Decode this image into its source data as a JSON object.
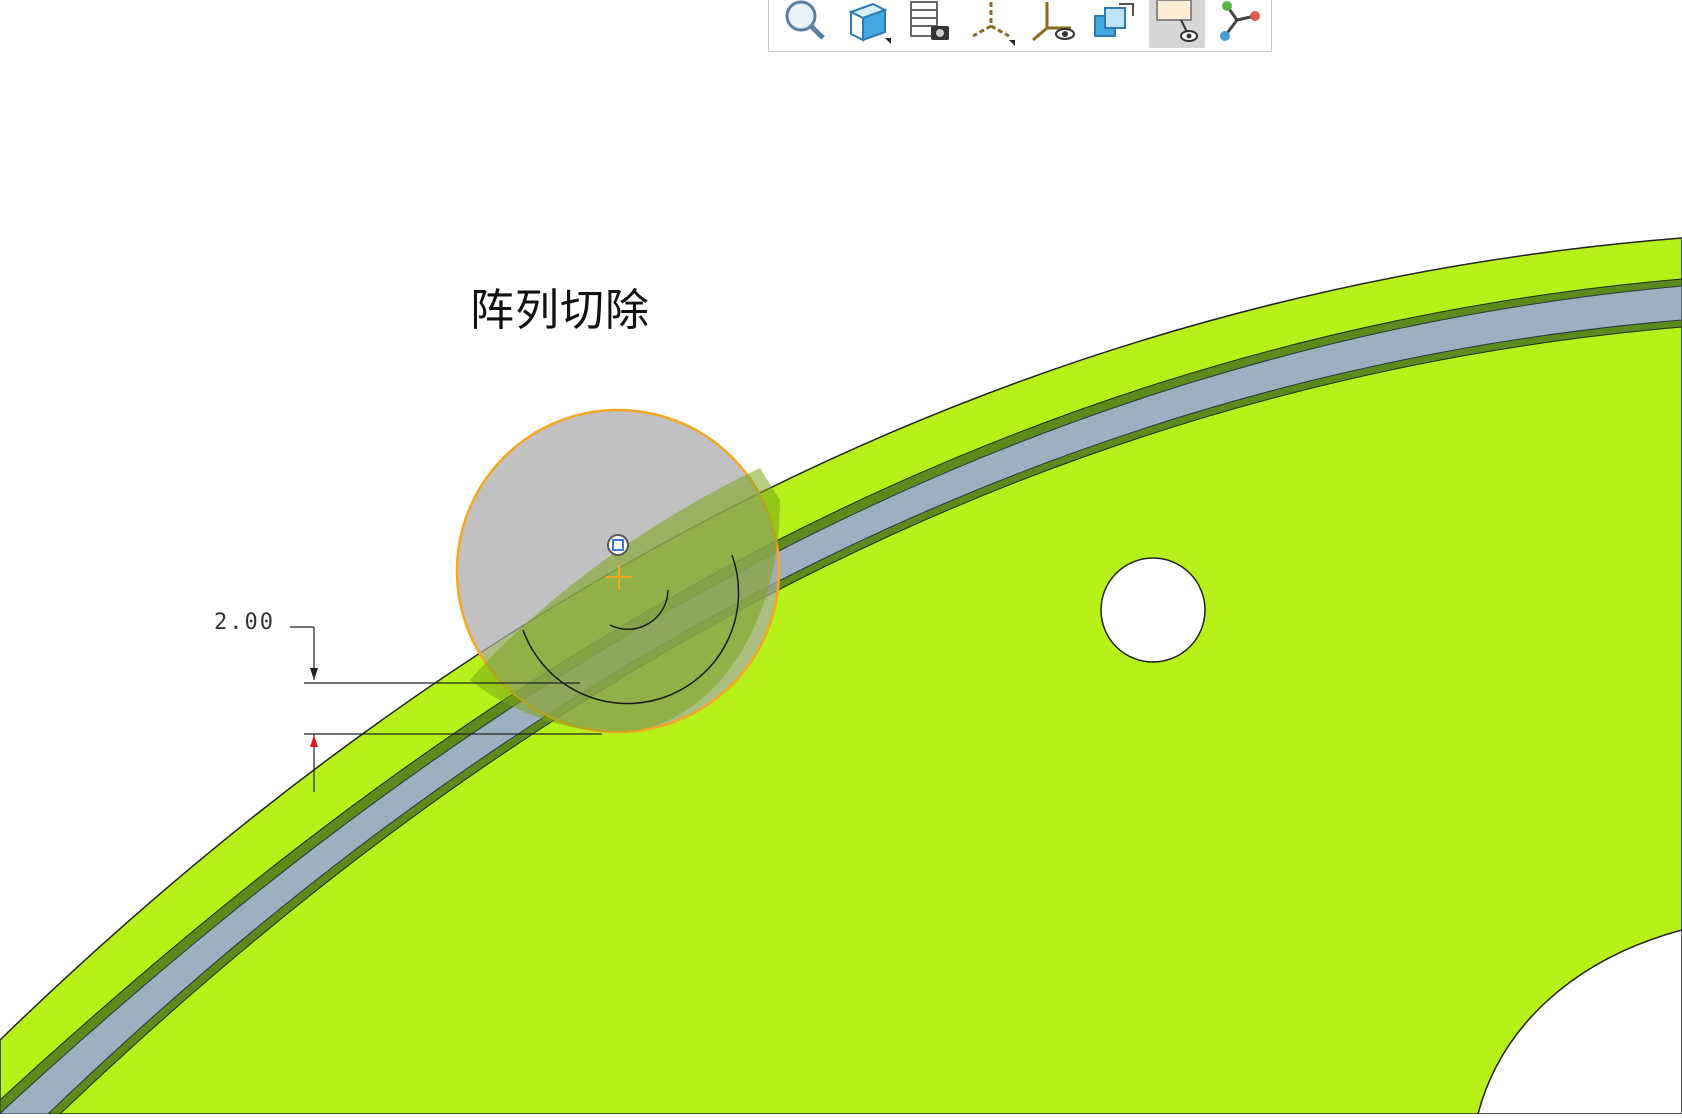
{
  "toolbar": {
    "buttons": [
      {
        "icon": "zoom-icon",
        "active": false
      },
      {
        "icon": "view-cube-icon",
        "active": false
      },
      {
        "icon": "saved-views-icon",
        "active": false
      },
      {
        "icon": "datum-axis-display-icon",
        "active": false
      },
      {
        "icon": "coordinate-system-display-icon",
        "active": false
      },
      {
        "icon": "spin-center-icon",
        "active": false
      },
      {
        "icon": "annotation-display-icon",
        "active": true
      },
      {
        "icon": "model-tree-icon",
        "active": false
      }
    ]
  },
  "model": {
    "feature_label": "阵列切除",
    "dimension_value": "2.00",
    "colors": {
      "part": "#b6f21a",
      "groove": "#9eafbf",
      "groove_edge": "#5d8a1b",
      "highlight": "#f5a623",
      "preview_sphere": "#a9a9a9"
    }
  }
}
